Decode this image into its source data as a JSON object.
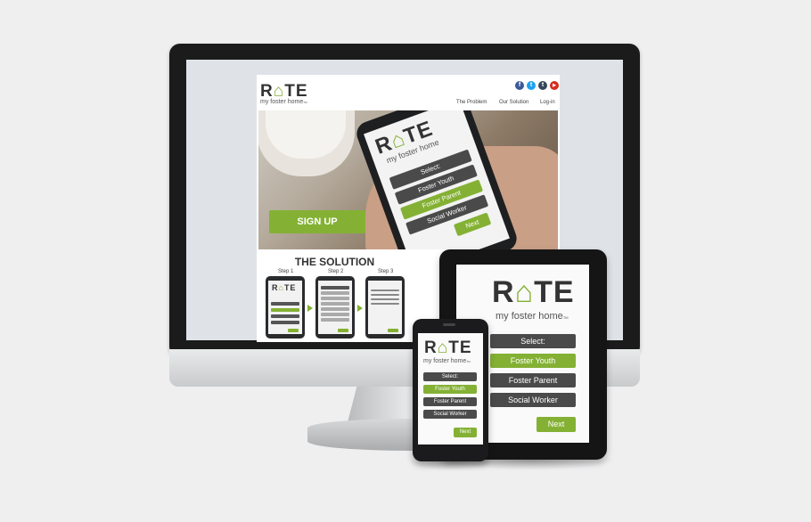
{
  "site": {
    "logo_main_pre": "R",
    "logo_main_post": "TE",
    "logo_sub": "my foster home",
    "logo_tm": "TM",
    "nav": [
      {
        "label": "The Problem"
      },
      {
        "label": "Our Solution"
      },
      {
        "label": "Log-in"
      }
    ],
    "social": [
      {
        "name": "facebook-icon",
        "glyph": "f",
        "color": "#3b5998"
      },
      {
        "name": "twitter-icon",
        "glyph": "t",
        "color": "#1da1f2"
      },
      {
        "name": "tumblr-icon",
        "glyph": "t",
        "color": "#35465c"
      },
      {
        "name": "youtube-icon",
        "glyph": "▶",
        "color": "#d62d20"
      }
    ],
    "signup_label": "SIGN UP",
    "solution_title": "THE SOLUTION",
    "steps": [
      "Step 1",
      "Step 2",
      "Step 3"
    ]
  },
  "app": {
    "logo_main_pre": "R",
    "logo_main_post": "TE",
    "logo_sub": "my foster home",
    "logo_tm": "TM",
    "select_label": "Select:",
    "options": [
      "Foster Youth",
      "Foster Parent",
      "Social Worker"
    ],
    "next_label": "Next"
  },
  "colors": {
    "brand_green": "#84b134",
    "button_dark": "#4a4a4a",
    "device_black": "#1b1b1c"
  }
}
